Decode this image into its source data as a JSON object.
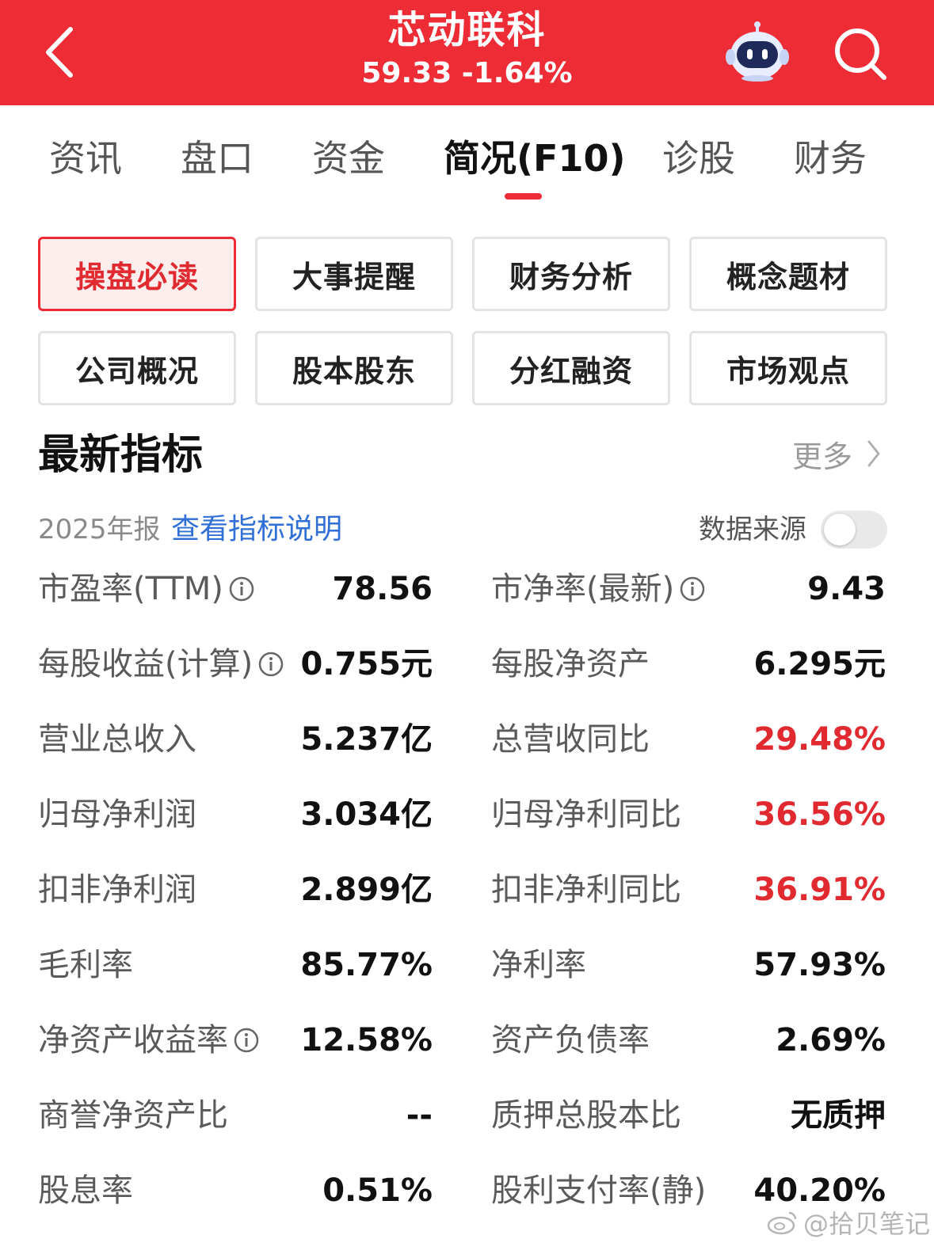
{
  "header": {
    "title": "芯动联科",
    "price_line": "59.33 -1.64%"
  },
  "tabs": [
    {
      "label": "资讯"
    },
    {
      "label": "盘口"
    },
    {
      "label": "资金"
    },
    {
      "label": "简况(F10)"
    },
    {
      "label": "诊股"
    },
    {
      "label": "财务"
    }
  ],
  "active_tab": "简况(F10)",
  "quick_buttons": [
    {
      "label": "操盘必读"
    },
    {
      "label": "大事提醒"
    },
    {
      "label": "财务分析"
    },
    {
      "label": "概念题材"
    },
    {
      "label": "公司概况"
    },
    {
      "label": "股本股东"
    },
    {
      "label": "分红融资"
    },
    {
      "label": "市场观点"
    }
  ],
  "active_quick_button": "操盘必读",
  "section": {
    "title": "最新指标",
    "more_label": "更多",
    "report_label": "2025年报",
    "explain_link": "查看指标说明",
    "source_label": "数据来源"
  },
  "metrics": [
    {
      "left": {
        "label": "市盈率(TTM)",
        "value": "78.56"
      },
      "right": {
        "label": "市净率(最新)",
        "value": "9.43"
      }
    },
    {
      "left": {
        "label": "每股收益(计算)",
        "value": "0.755元"
      },
      "right": {
        "label": "每股净资产",
        "value": "6.295元"
      }
    },
    {
      "left": {
        "label": "营业总收入",
        "value": "5.237亿"
      },
      "right": {
        "label": "总营收同比",
        "value": "29.48%"
      }
    },
    {
      "left": {
        "label": "归母净利润",
        "value": "3.034亿"
      },
      "right": {
        "label": "归母净利同比",
        "value": "36.56%"
      }
    },
    {
      "left": {
        "label": "扣非净利润",
        "value": "2.899亿"
      },
      "right": {
        "label": "扣非净利同比",
        "value": "36.91%"
      }
    },
    {
      "left": {
        "label": "毛利率",
        "value": "85.77%"
      },
      "right": {
        "label": "净利率",
        "value": "57.93%"
      }
    },
    {
      "left": {
        "label": "净资产收益率",
        "value": "12.58%"
      },
      "right": {
        "label": "资产负债率",
        "value": "2.69%"
      }
    },
    {
      "left": {
        "label": "商誉净资产比",
        "value": "--"
      },
      "right": {
        "label": "质押总股本比",
        "value": "无质押"
      }
    },
    {
      "left": {
        "label": "股息率",
        "value": "0.51%"
      },
      "right": {
        "label": "股利支付率(静)",
        "value": "40.20%"
      }
    }
  ],
  "watermark": "@拾贝笔记",
  "colors": {
    "brand_red": "#ee2c36",
    "positive_red": "#e02a30",
    "link_blue": "#2f6fd6"
  },
  "icons": {
    "back": "chevron-left-icon",
    "assistant": "robot-icon",
    "search": "search-icon",
    "more": "chevron-right-icon",
    "info": "info-icon"
  }
}
